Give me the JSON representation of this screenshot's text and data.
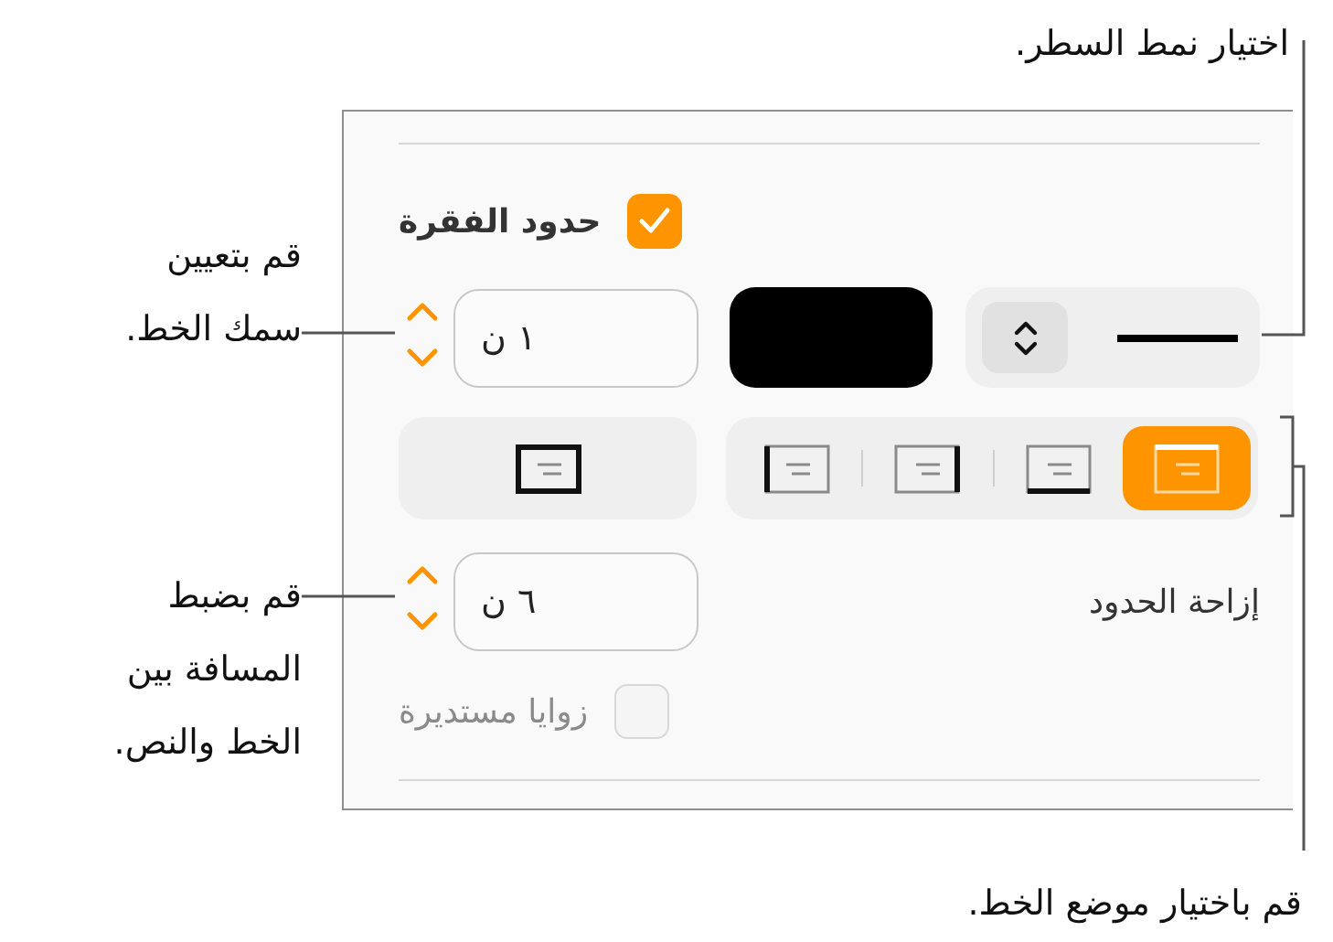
{
  "callouts": [
    {
      "lines": [
        "اختيار نمط السطر."
      ]
    },
    {
      "lines": [
        "قم بتعيين",
        "سمك الخط."
      ]
    },
    {
      "lines": [
        "قم بضبط",
        "المسافة بين",
        "الخط والنص."
      ]
    },
    {
      "lines": [
        "قم باختيار موضع الخط."
      ]
    }
  ],
  "panel": {
    "border_checkbox": {
      "label": "حدود الفقرة",
      "checked": true
    },
    "width_field": {
      "value": "١ ن"
    },
    "border_presets": [
      {
        "kind": "all"
      }
    ],
    "border_positions": [
      {
        "kind": "top",
        "selected": true
      },
      {
        "kind": "bottom",
        "selected": false
      },
      {
        "kind": "right",
        "selected": false
      },
      {
        "kind": "left",
        "selected": false
      }
    ],
    "offset": {
      "label": "إزاحة الحدود",
      "value": "٦ ن"
    },
    "rounded_checkbox": {
      "label": "زوايا مستديرة",
      "checked": false,
      "disabled": true
    }
  }
}
